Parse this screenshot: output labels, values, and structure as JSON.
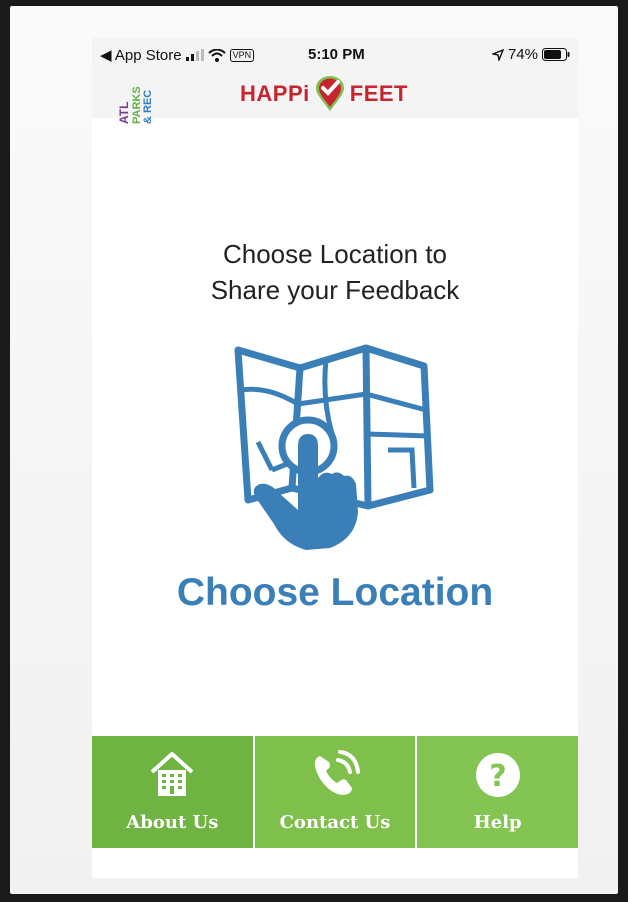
{
  "status_bar": {
    "back_label": "◀ App Store",
    "vpn": "VPN",
    "time": "5:10 PM",
    "battery": "74%"
  },
  "header": {
    "left_logo_lines": [
      "ATL",
      "PARKS",
      "& REC"
    ],
    "brand_left": "HAPPi",
    "brand_right": "FEET",
    "colors": {
      "brand_red": "#c8242f",
      "atl_purple": "#7a3b8f",
      "atl_blue": "#2f7fc1",
      "atl_green": "#64b345"
    }
  },
  "main": {
    "subtitle_line1": "Choose Location to",
    "subtitle_line2": "Share your Feedback",
    "illustration_icon": "map-touch-icon",
    "choose_button": "Choose Location",
    "accent_color": "#3a7fb8"
  },
  "nav": {
    "items": [
      {
        "label": "About Us",
        "icon": "building-icon"
      },
      {
        "label": "Contact Us",
        "icon": "phone-icon"
      },
      {
        "label": "Help",
        "icon": "question-icon"
      }
    ],
    "color": "#7fbf4b"
  }
}
